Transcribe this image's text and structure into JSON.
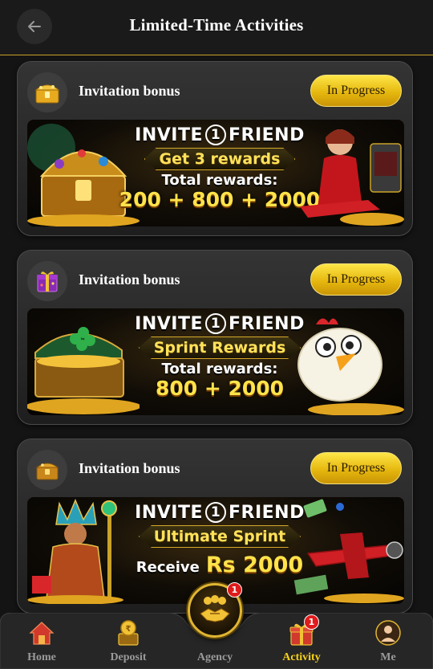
{
  "header": {
    "title": "Limited-Time Activities",
    "back_icon": "arrow-left-icon"
  },
  "activities": [
    {
      "title": "Invitation bonus",
      "status": "In Progress",
      "icon": "treasure-chest-icon",
      "banner": {
        "invite_prefix": "INVITE",
        "invite_number": "1",
        "invite_suffix": "FRIEND",
        "ribbon": "Get 3 rewards",
        "subtitle": "Total rewards:",
        "amount": "200 + 800 + 2000"
      }
    },
    {
      "title": "Invitation bonus",
      "status": "In Progress",
      "icon": "gift-box-icon",
      "banner": {
        "invite_prefix": "INVITE",
        "invite_number": "1",
        "invite_suffix": "FRIEND",
        "ribbon": "Sprint Rewards",
        "subtitle": "Total rewards:",
        "amount": "800 + 2000"
      }
    },
    {
      "title": "Invitation bonus",
      "status": "In Progress",
      "icon": "treasure-chest-icon",
      "banner": {
        "invite_prefix": "INVITE",
        "invite_number": "1",
        "invite_suffix": "FRIEND",
        "ribbon": "Ultimate Sprint",
        "receive_label": "Receive",
        "amount": "Rs 2000"
      }
    }
  ],
  "nav": {
    "items": [
      {
        "label": "Home",
        "icon": "home-icon",
        "active": false
      },
      {
        "label": "Deposit",
        "icon": "deposit-icon",
        "active": false
      },
      {
        "label": "Agency",
        "icon": "handshake-icon",
        "active": false,
        "badge": "1"
      },
      {
        "label": "Activity",
        "icon": "gift-icon",
        "active": true,
        "badge": "1"
      },
      {
        "label": "Me",
        "icon": "user-avatar-icon",
        "active": false
      }
    ]
  },
  "colors": {
    "accent_gold": "#f5d21c",
    "button_gold": "#e6b80f",
    "background": "#141414",
    "badge_red": "#e01b1b"
  }
}
